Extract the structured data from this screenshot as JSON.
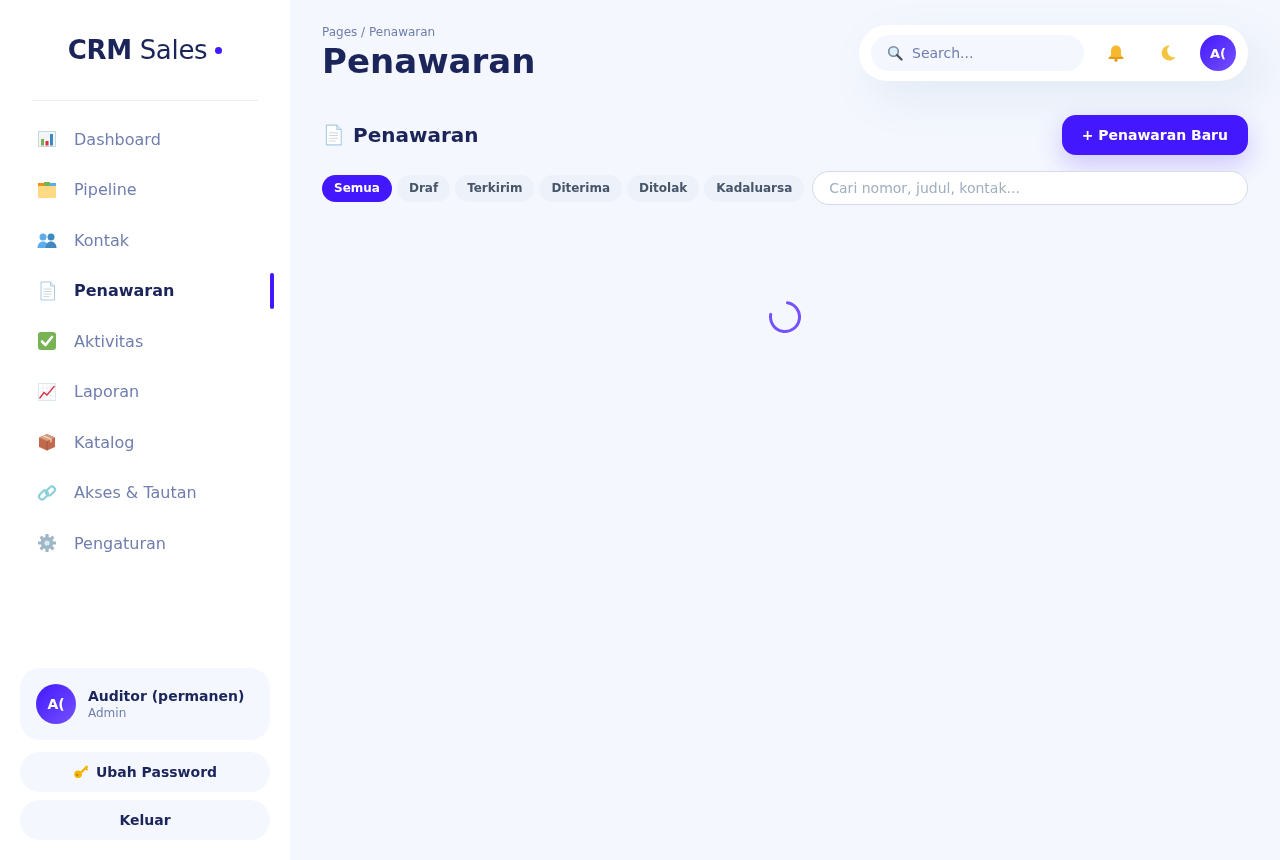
{
  "sidebar": {
    "logo": "**CRM** Sales",
    "nav_items": [
      {
        "label": "Dashboard",
        "selected": false
      },
      {
        "label": "Pipeline",
        "selected": false
      },
      {
        "label": "Kontak",
        "selected": false
      },
      {
        "label": "Penawaran",
        "selected": true
      },
      {
        "label": "Aktivitas",
        "selected": false
      },
      {
        "label": "Laporan",
        "selected": false
      },
      {
        "label": "Katalog",
        "selected": false
      },
      {
        "label": "Akses & Tautan",
        "selected": false
      },
      {
        "label": "Pengaturan",
        "selected": false
      }
    ],
    "user": {
      "initials": "A(",
      "name": "Auditor (permanen)",
      "role": "Admin"
    },
    "buttons": [
      "Ubah Password",
      "Keluar"
    ]
  },
  "header": {
    "breadcrumb": "Pages / Penawaran",
    "title": "Penawaran",
    "search": {
      "placeholder": "Search..."
    },
    "avatar": "A("
  },
  "section": {
    "title": "Penawaran",
    "new_button": "+ Penawaran Baru",
    "filters": [
      {
        "label": "Semua",
        "selected": true
      },
      {
        "label": "Draf",
        "selected": false
      },
      {
        "label": "Terkirim",
        "selected": false
      },
      {
        "label": "Diterima",
        "selected": false
      },
      {
        "label": "Ditolak",
        "selected": false
      },
      {
        "label": "Kadaluarsa",
        "selected": false
      }
    ],
    "search": {
      "placeholder": "Cari nomor, judul, kontak..."
    },
    "loading": true
  }
}
